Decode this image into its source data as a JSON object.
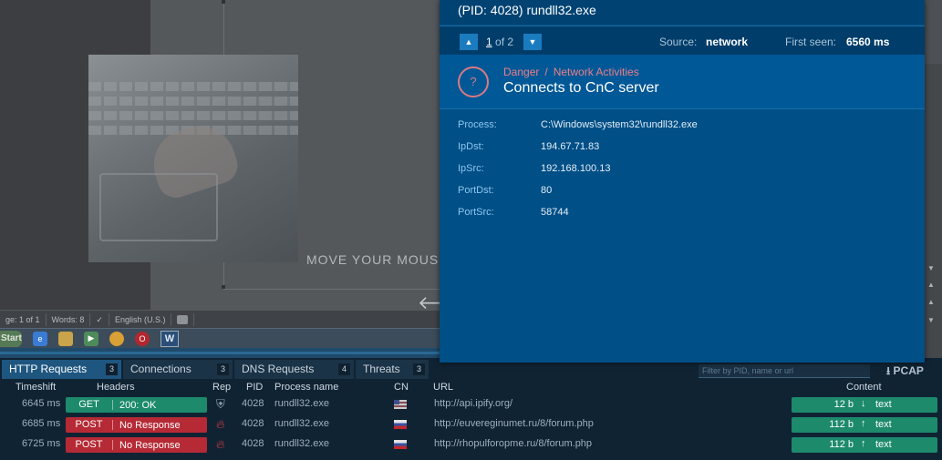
{
  "vm": {
    "caption": "MOVE YOUR MOUSE",
    "status": {
      "page": "ge: 1 of 1",
      "words": "Words: 8",
      "language": "English (U.S.)"
    },
    "taskbar": {
      "start_label": "Start",
      "word_label": "W"
    }
  },
  "popup": {
    "title": "(PID: 4028) rundll32.exe",
    "nav": {
      "current": "1",
      "of_total": " of 2",
      "source_label": "Source:",
      "source_value": "network",
      "first_seen_label": "First seen:",
      "first_seen_value": "6560 ms"
    },
    "threat": {
      "severity": "Danger",
      "separator": "/",
      "category": "Network Activities",
      "name": "Connects to CnC server",
      "icon_glyph": "?"
    },
    "details": [
      {
        "label": "Process:",
        "value": "C:\\Windows\\system32\\rundll32.exe"
      },
      {
        "label": "IpDst:",
        "value": "194.67.71.83"
      },
      {
        "label": "IpSrc:",
        "value": "192.168.100.13"
      },
      {
        "label": "PortDst:",
        "value": "80"
      },
      {
        "label": "PortSrc:",
        "value": "58744"
      }
    ]
  },
  "bottom": {
    "tabs": [
      {
        "label": "HTTP Requests",
        "count": "3"
      },
      {
        "label": "Connections",
        "count": "3"
      },
      {
        "label": "DNS Requests",
        "count": "4"
      },
      {
        "label": "Threats",
        "count": "3"
      }
    ],
    "filter_placeholder": "Filter by PID, name or url",
    "pcap_label": "PCAP",
    "columns": {
      "timeshift": "Timeshift",
      "headers": "Headers",
      "rep": "Rep",
      "pid": "PID",
      "process": "Process name",
      "cn": "CN",
      "url": "URL",
      "content": "Content"
    },
    "rows": [
      {
        "time": "6645 ms",
        "method": "GET",
        "status": "200: OK",
        "pid": "4028",
        "process": "rundll32.exe",
        "url": "http://api.ipify.org/",
        "size": "12 b",
        "dir": "↓",
        "kind": "text"
      },
      {
        "time": "6685 ms",
        "method": "POST",
        "status": "No Response",
        "pid": "4028",
        "process": "rundll32.exe",
        "url": "http://euvereginumet.ru/8/forum.php",
        "size": "112 b",
        "dir": "↑",
        "kind": "text"
      },
      {
        "time": "6725 ms",
        "method": "POST",
        "status": "No Response",
        "pid": "4028",
        "process": "rundll32.exe",
        "url": "http://rhopulforopme.ru/8/forum.php",
        "size": "112 b",
        "dir": "↑",
        "kind": "text"
      }
    ]
  }
}
